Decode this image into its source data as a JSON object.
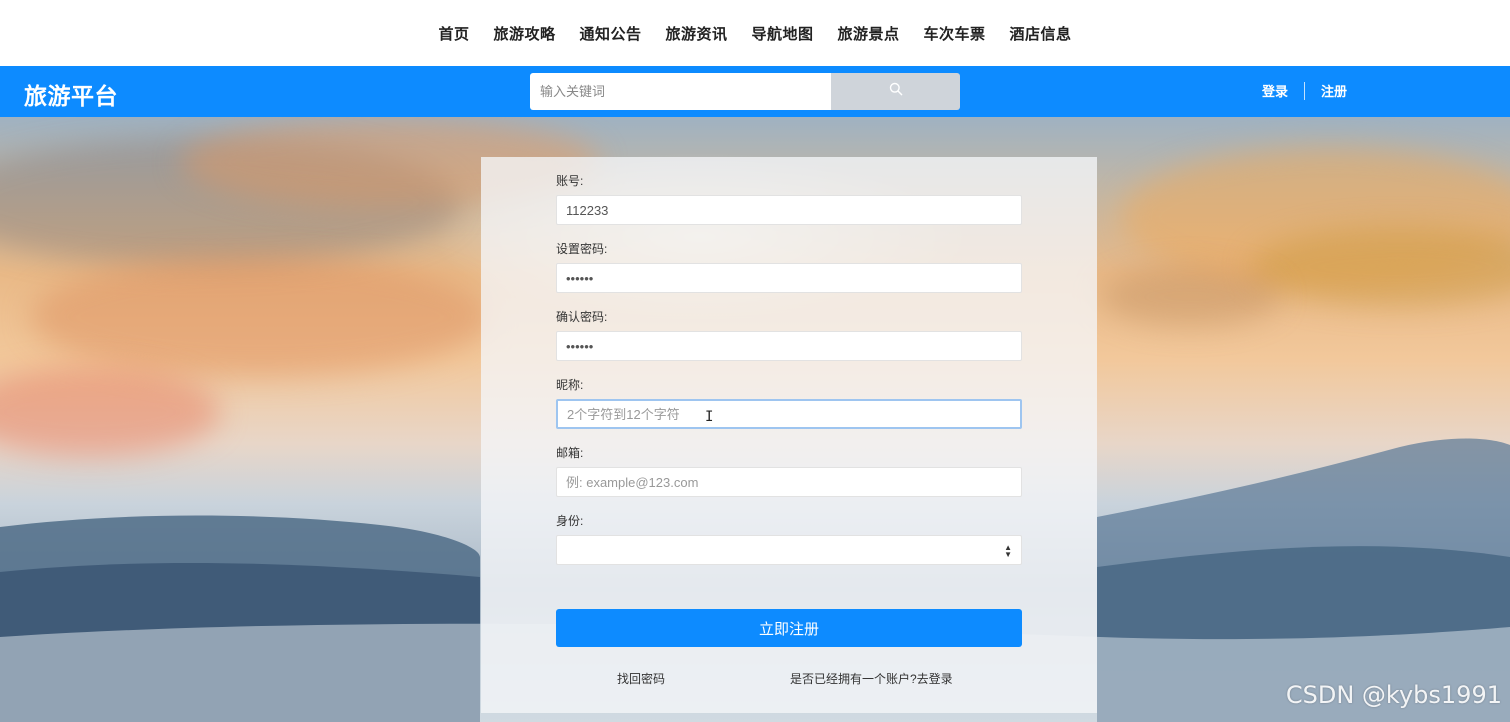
{
  "topnav": {
    "items": [
      "首页",
      "旅游攻略",
      "通知公告",
      "旅游资讯",
      "导航地图",
      "旅游景点",
      "车次车票",
      "酒店信息"
    ]
  },
  "header": {
    "brand": "旅游平台",
    "search_placeholder": "输入关键词",
    "search_icon": "search-icon",
    "login": "登录",
    "register": "注册",
    "bar_color": "#0d8bff"
  },
  "form": {
    "account_label": "账号:",
    "account_value": "112233",
    "password_label": "设置密码:",
    "password_value": "••••••",
    "confirm_label": "确认密码:",
    "confirm_value": "••••••",
    "nickname_label": "昵称:",
    "nickname_placeholder": "2个字符到12个字符",
    "email_label": "邮箱:",
    "email_placeholder": "例: example@123.com",
    "identity_label": "身份:",
    "identity_value": "",
    "submit": "立即注册",
    "forgot": "找回密码",
    "have_account": "是否已经拥有一个账户?去登录"
  },
  "watermark": "CSDN @kybs1991"
}
